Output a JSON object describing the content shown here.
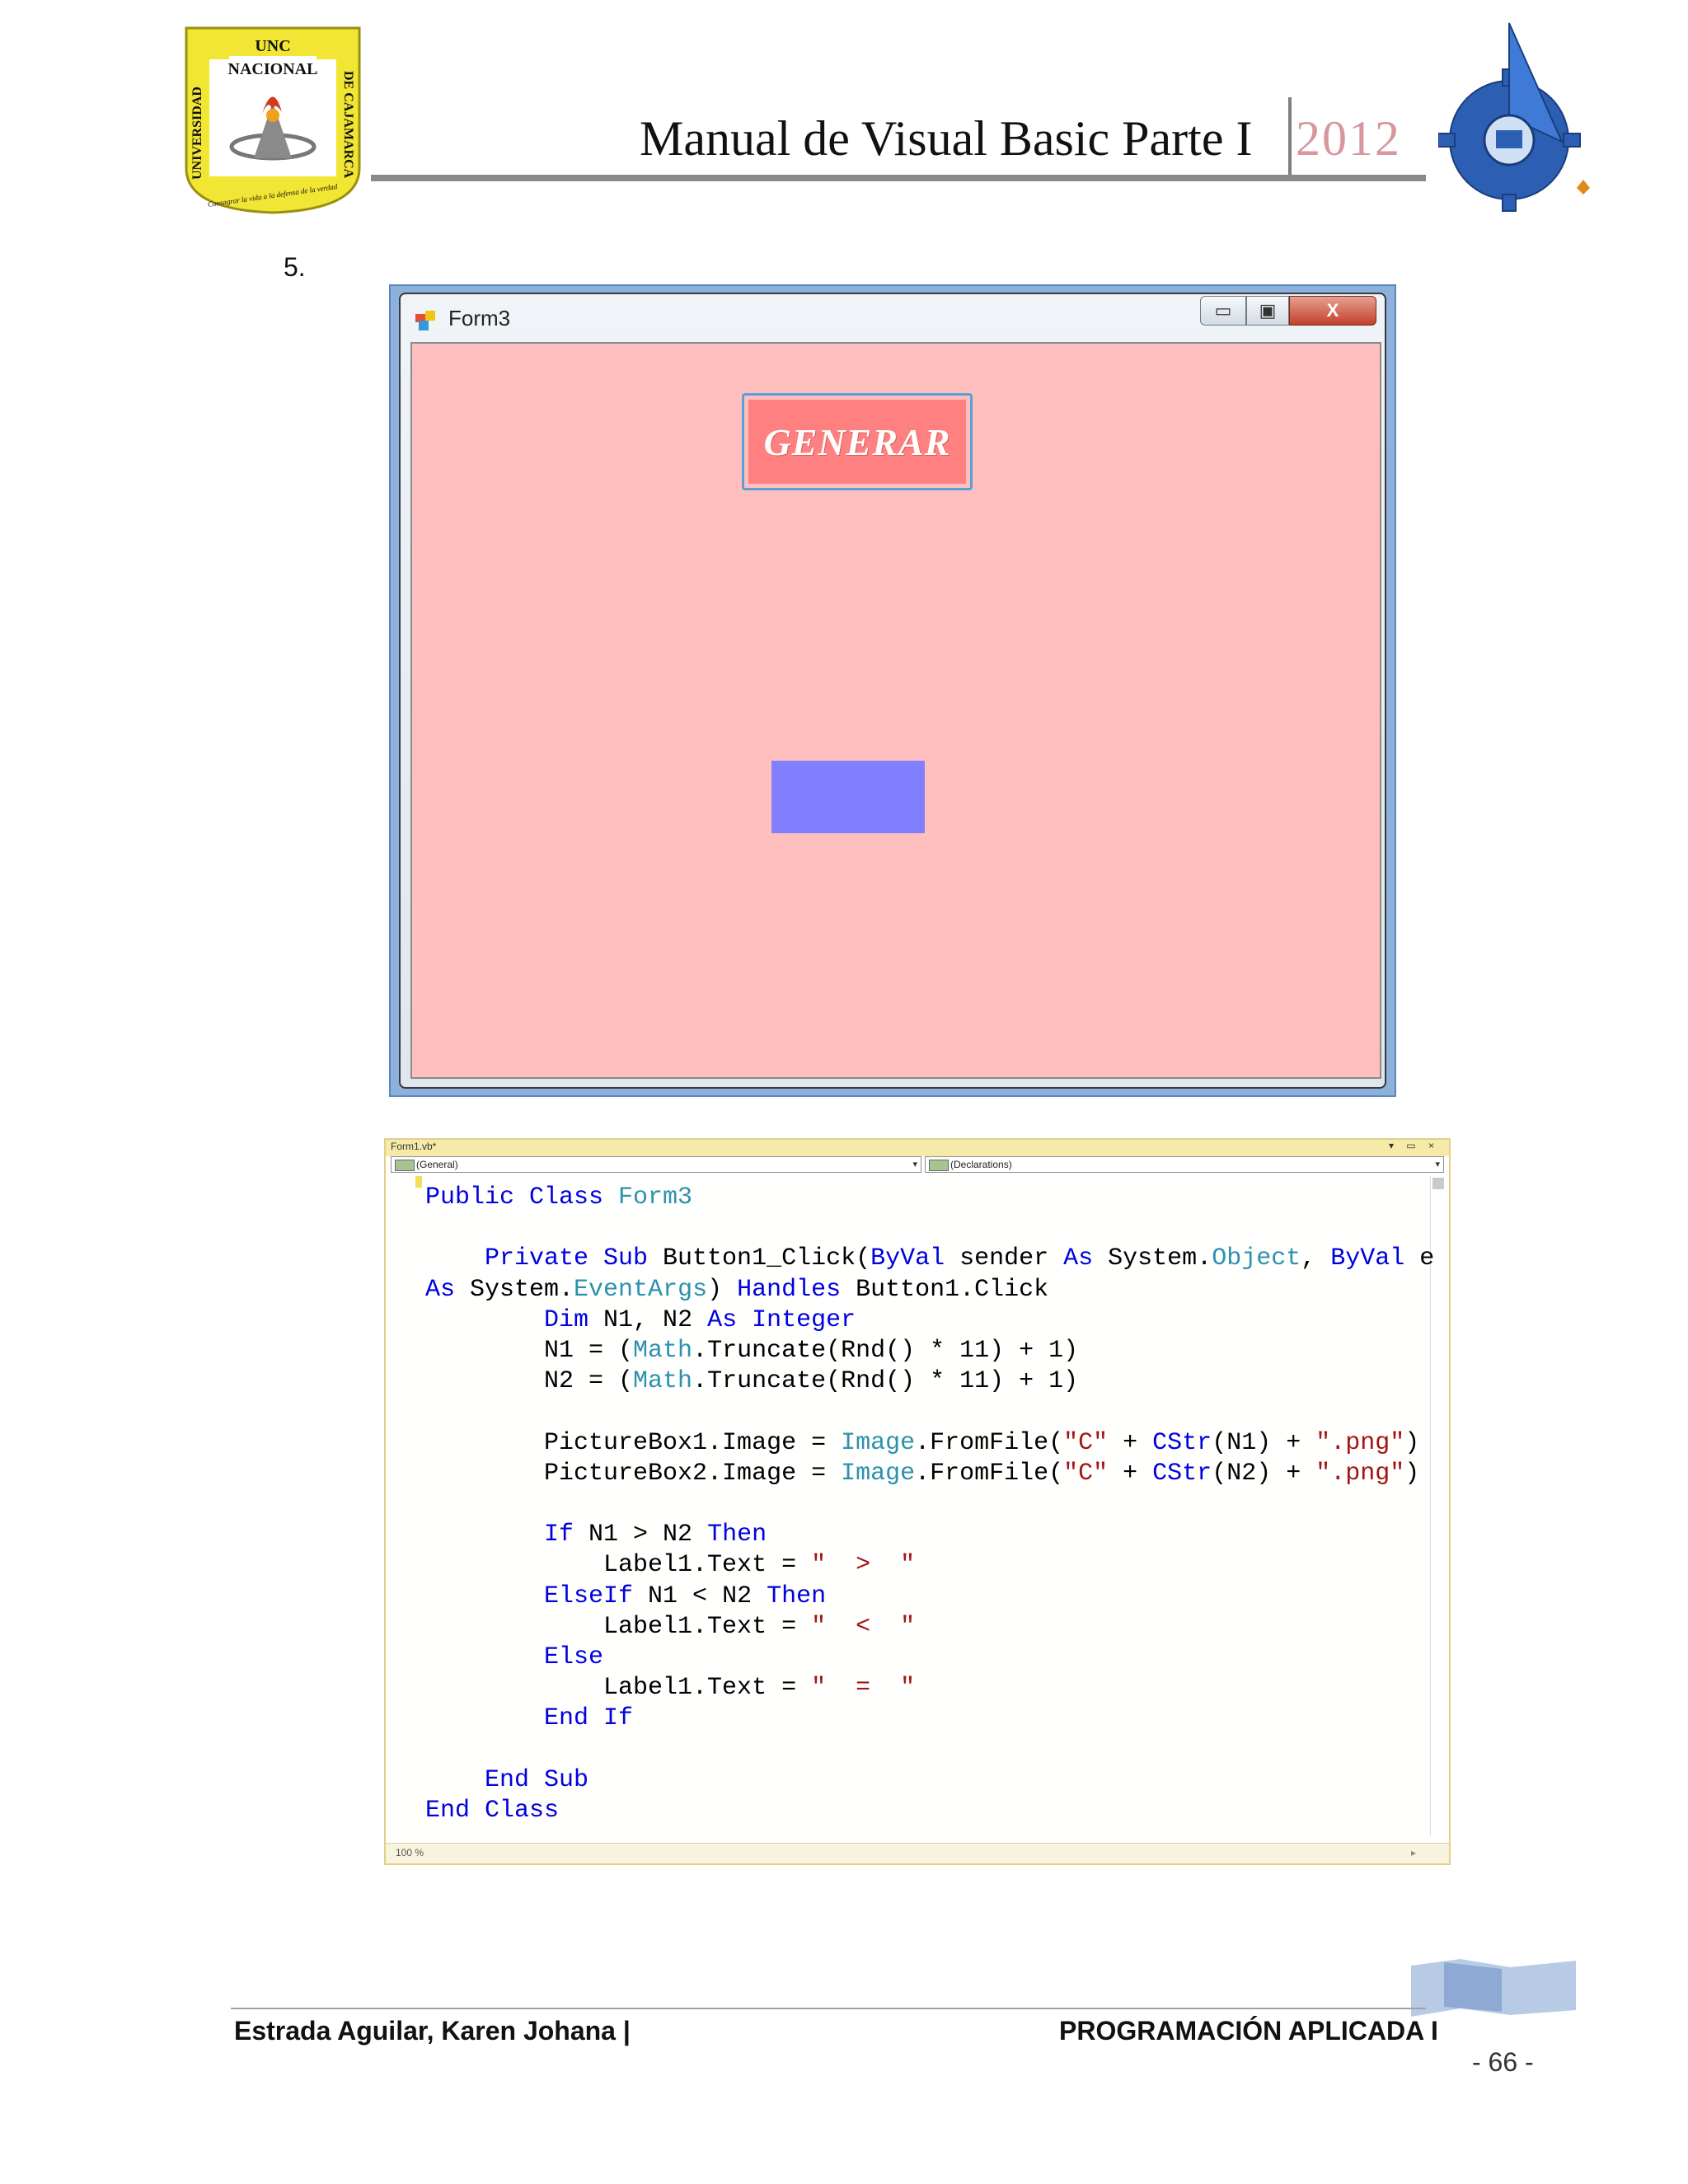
{
  "header": {
    "title": "Manual de Visual Basic Parte I",
    "year": "2012",
    "logo_left": {
      "top_text": "UNC",
      "name_text": "NACIONAL",
      "side_left": "UNIVERSIDAD",
      "side_right": "DE CAJAMARCA",
      "motto": "Consagrar la vida a la defensa de la verdad"
    }
  },
  "step_number": "5.",
  "form_window": {
    "title": "Form3",
    "button_label": "GENERAR",
    "client_color": "#ffbfbf",
    "button_color": "#ff8080",
    "picturebox_color": "#8080ff"
  },
  "code_editor": {
    "tab_label": "Form1.vb*",
    "object_combo": "(General)",
    "procedure_combo": "(Declarations)",
    "zoom": "100 %",
    "code": [
      [
        [
          "Public Class ",
          "kw"
        ],
        [
          "Form3",
          "ty"
        ]
      ],
      [],
      [
        [
          "    Private Sub ",
          "kw"
        ],
        [
          "Button1_Click(",
          ""
        ],
        [
          "ByVal",
          "kw"
        ],
        [
          " sender ",
          ""
        ],
        [
          "As",
          "kw"
        ],
        [
          " System.",
          ""
        ],
        [
          "Object",
          "ty"
        ],
        [
          ", ",
          ""
        ],
        [
          "ByVal",
          "kw"
        ],
        [
          " e",
          ""
        ]
      ],
      [
        [
          "As",
          "kw"
        ],
        [
          " System.",
          ""
        ],
        [
          "EventArgs",
          "ty"
        ],
        [
          ") ",
          ""
        ],
        [
          "Handles",
          "kw"
        ],
        [
          " Button1.Click",
          ""
        ]
      ],
      [
        [
          "        Dim",
          "kw"
        ],
        [
          " N1, N2 ",
          ""
        ],
        [
          "As Integer",
          "kw"
        ]
      ],
      [
        [
          "        N1 = (",
          ""
        ],
        [
          "Math",
          "ty"
        ],
        [
          ".Truncate(Rnd() * 11) + 1)",
          ""
        ]
      ],
      [
        [
          "        N2 = (",
          ""
        ],
        [
          "Math",
          "ty"
        ],
        [
          ".Truncate(Rnd() * 11) + 1)",
          ""
        ]
      ],
      [],
      [
        [
          "        PictureBox1.Image = ",
          ""
        ],
        [
          "Image",
          "ty"
        ],
        [
          ".FromFile(",
          ""
        ],
        [
          "\"C\"",
          "st"
        ],
        [
          " + ",
          ""
        ],
        [
          "CStr",
          "kw"
        ],
        [
          "(N1) + ",
          ""
        ],
        [
          "\".png\"",
          "st"
        ],
        [
          ")",
          ""
        ]
      ],
      [
        [
          "        PictureBox2.Image = ",
          ""
        ],
        [
          "Image",
          "ty"
        ],
        [
          ".FromFile(",
          ""
        ],
        [
          "\"C\"",
          "st"
        ],
        [
          " + ",
          ""
        ],
        [
          "CStr",
          "kw"
        ],
        [
          "(N2) + ",
          ""
        ],
        [
          "\".png\"",
          "st"
        ],
        [
          ")",
          ""
        ]
      ],
      [],
      [
        [
          "        If",
          "kw"
        ],
        [
          " N1 > N2 ",
          ""
        ],
        [
          "Then",
          "kw"
        ]
      ],
      [
        [
          "            Label1.Text = ",
          ""
        ],
        [
          "\"  >  \"",
          "st"
        ]
      ],
      [
        [
          "        ElseIf",
          "kw"
        ],
        [
          " N1 < N2 ",
          ""
        ],
        [
          "Then",
          "kw"
        ]
      ],
      [
        [
          "            Label1.Text = ",
          ""
        ],
        [
          "\"  <  \"",
          "st"
        ]
      ],
      [
        [
          "        Else",
          "kw"
        ]
      ],
      [
        [
          "            Label1.Text = ",
          ""
        ],
        [
          "\"  =  \"",
          "st"
        ]
      ],
      [
        [
          "        End If",
          "kw"
        ]
      ],
      [],
      [
        [
          "    End Sub",
          "kw"
        ]
      ],
      [
        [
          "End Class",
          "kw"
        ]
      ]
    ]
  },
  "footer": {
    "author": "Estrada Aguilar, Karen Johana |",
    "course": "PROGRAMACIÓN APLICADA I",
    "page": "- 66 -"
  },
  "colors": {
    "year_accent": "#d7979b",
    "vb_keyword": "#0000e0",
    "vb_type": "#2b91af",
    "vb_string": "#a31515"
  }
}
